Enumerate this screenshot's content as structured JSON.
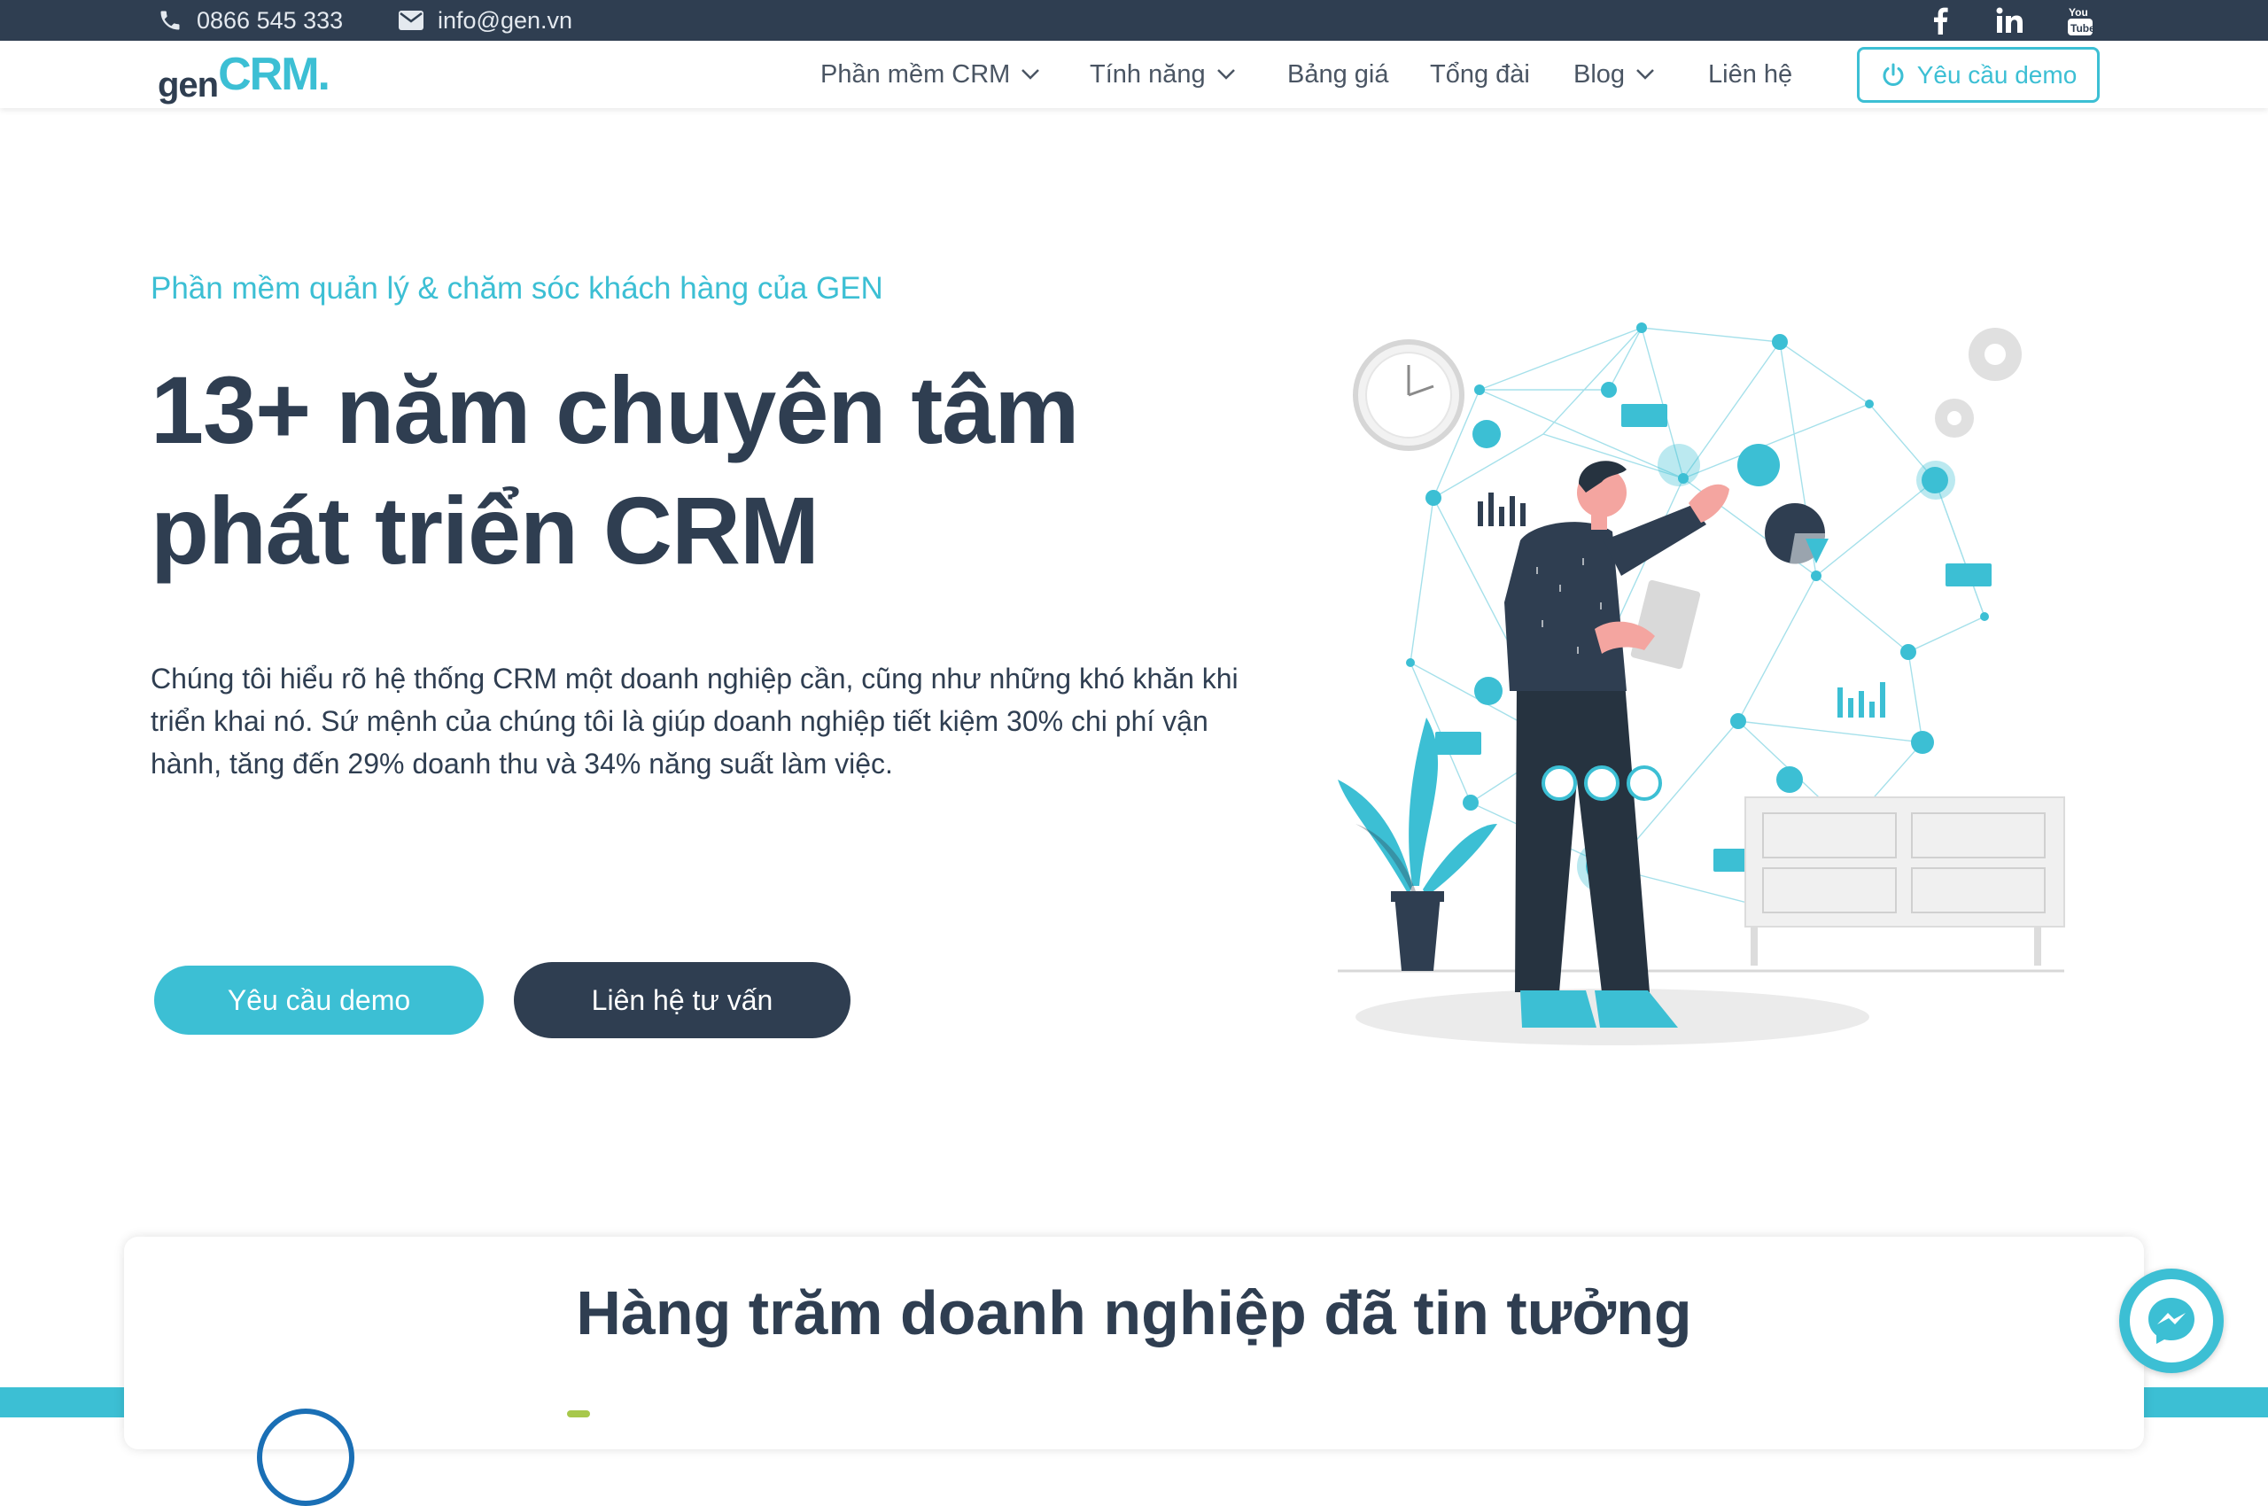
{
  "topbar": {
    "phone": "0866 545 333",
    "email": "info@gen.vn",
    "social": [
      "facebook-icon",
      "linkedin-icon",
      "youtube-icon"
    ]
  },
  "logo": {
    "gen": "gen",
    "crm": "CRM",
    "dot": "."
  },
  "nav": {
    "items": [
      {
        "label": "Phần mềm CRM",
        "has_dropdown": true
      },
      {
        "label": "Tính năng",
        "has_dropdown": true
      },
      {
        "label": "Bảng giá",
        "has_dropdown": false
      },
      {
        "label": "Tổng đài",
        "has_dropdown": false
      },
      {
        "label": "Blog",
        "has_dropdown": true
      },
      {
        "label": "Liên hệ",
        "has_dropdown": false
      }
    ],
    "demo_button": "Yêu cầu demo"
  },
  "hero": {
    "eyebrow": "Phần mềm quản lý & chăm sóc khách hàng của GEN",
    "headline_line1": "13+ năm chuyên tâm",
    "headline_line2": "phát triển CRM",
    "lead": "Chúng tôi hiểu rõ hệ thống CRM một doanh nghiệp cần, cũng như những khó khăn khi triển khai nó. Sứ mệnh của chúng tôi là giúp doanh nghiệp tiết kiệm 30% chi phí vận hành, tăng đến 29% doanh thu và 34% năng suất làm việc.",
    "primary_button": "Yêu cầu demo",
    "secondary_button": "Liên hệ tư vấn"
  },
  "trust": {
    "title": "Hàng trăm doanh nghiệp đã tin tưởng"
  },
  "colors": {
    "primary": "#3cbfd4",
    "dark": "#2f3e51",
    "white": "#ffffff"
  }
}
